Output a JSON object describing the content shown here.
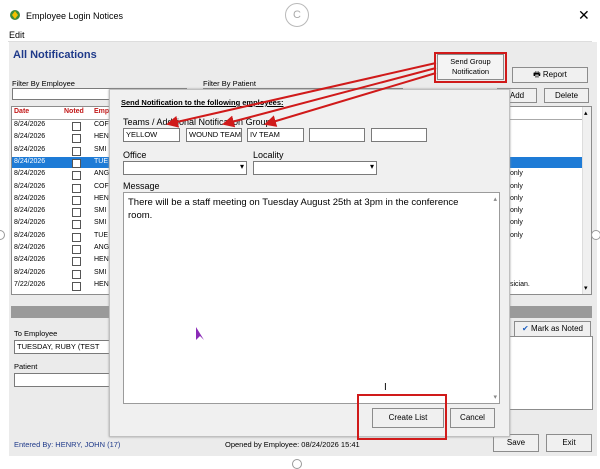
{
  "window": {
    "title": "Employee Login Notices",
    "close_glyph": "✕"
  },
  "menu": {
    "edit": "Edit"
  },
  "page": {
    "heading": "All Notifications"
  },
  "filters": {
    "employee_label": "Filter By Employee",
    "patient_label": "Filter By Patient"
  },
  "toolbar": {
    "send_group": "Send Group Notification",
    "report": "Report",
    "add": "Add",
    "delete": "Delete"
  },
  "table": {
    "headers": [
      "Date",
      "Noted",
      "Emp"
    ],
    "rows": [
      {
        "date": "8/24/2026",
        "emp": "COF",
        "tail": ""
      },
      {
        "date": "8/24/2026",
        "emp": "HEN",
        "tail": ""
      },
      {
        "date": "8/24/2026",
        "emp": "SMI",
        "tail": ""
      },
      {
        "date": "8/24/2026",
        "emp": "TUE",
        "tail": ""
      },
      {
        "date": "8/24/2026",
        "emp": "ANG",
        "tail": "only"
      },
      {
        "date": "8/24/2026",
        "emp": "COF",
        "tail": "only"
      },
      {
        "date": "8/24/2026",
        "emp": "HEN",
        "tail": "only"
      },
      {
        "date": "8/24/2026",
        "emp": "SMI",
        "tail": "only"
      },
      {
        "date": "8/24/2026",
        "emp": "SMI",
        "tail": "only"
      },
      {
        "date": "8/24/2026",
        "emp": "TUE",
        "tail": "only"
      },
      {
        "date": "8/24/2026",
        "emp": "ANG",
        "tail": ""
      },
      {
        "date": "8/24/2026",
        "emp": "HEN",
        "tail": ""
      },
      {
        "date": "8/24/2026",
        "emp": "SMI",
        "tail": ""
      },
      {
        "date": "7/22/2026",
        "emp": "HEN",
        "tail": "sician."
      }
    ],
    "selected_row": 3
  },
  "lower": {
    "to_employee_label": "To Employee",
    "to_employee_value": "TUESDAY, RUBY  (TEST",
    "patient_label": "Patient",
    "mark_noted": "Mark as Noted"
  },
  "footer": {
    "entered_by": "Entered By: HENRY, JOHN  (17)",
    "opened_by": "Opened by Employee:  08/24/2026 15:41",
    "save": "Save",
    "exit": "Exit"
  },
  "dialog": {
    "title": "Send Notification to the following employees:",
    "groups_label": "Teams / Additional Notification Groups",
    "groups": [
      "YELLOW",
      "WOUND TEAM",
      "IV TEAM",
      "",
      ""
    ],
    "office_label": "Office",
    "locality_label": "Locality",
    "message_label": "Message",
    "message": "There will be a staff meeting on Tuesday August 25th at 3pm in the conference room.",
    "create_list": "Create List",
    "cancel": "Cancel"
  },
  "colors": {
    "accent_red": "#d01a1a",
    "heading_blue": "#1f3a8a",
    "selection_blue": "#1e7bd6"
  }
}
